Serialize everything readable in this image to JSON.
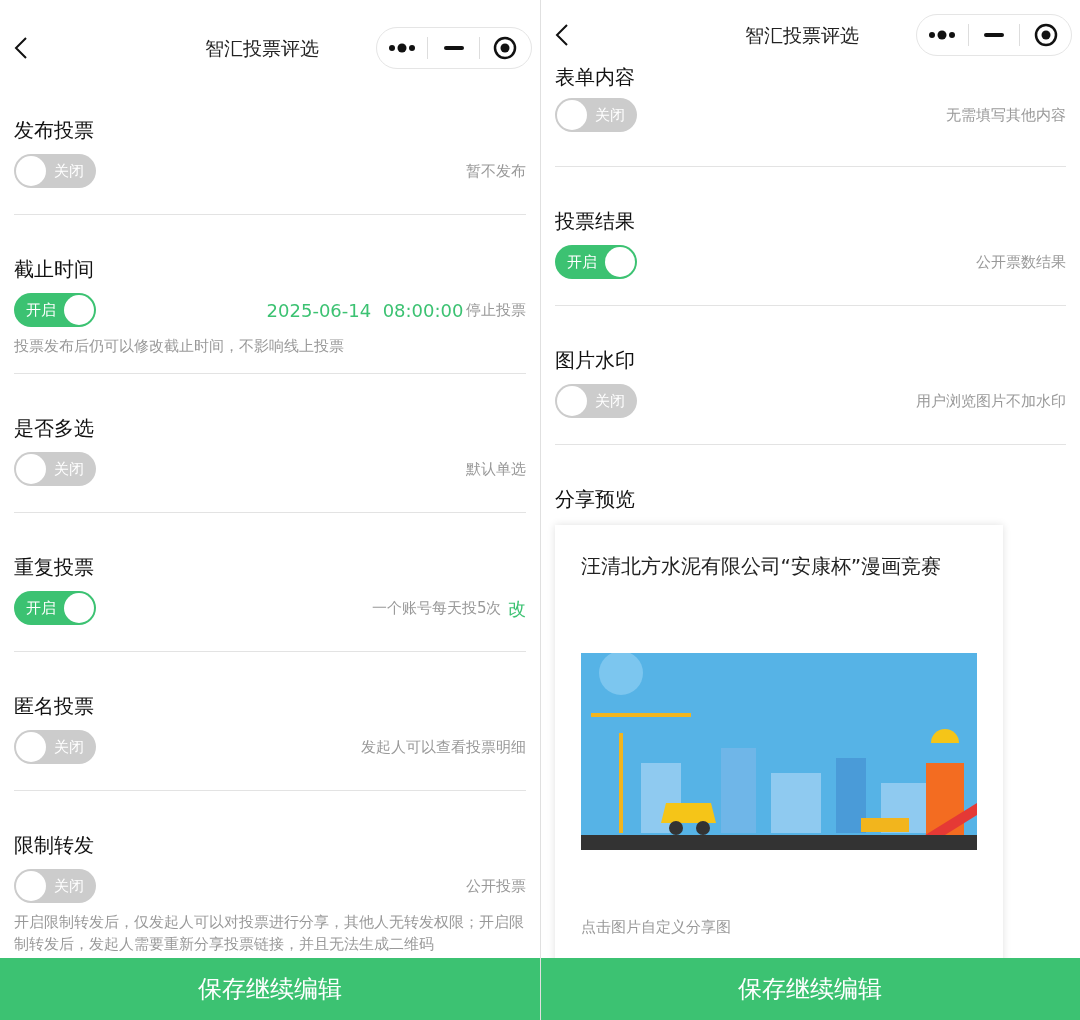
{
  "panels": [
    {
      "header": {
        "title": "智汇投票评选"
      },
      "sections": [
        {
          "kind": "toggle",
          "title": "发布投票",
          "switch": {
            "on": false,
            "label": "关闭"
          },
          "hint": "暂不发布"
        },
        {
          "kind": "toggle",
          "title": "截止时间",
          "switch": {
            "on": true,
            "label": "开启"
          },
          "datetime": "2025-06-14  08:00:00",
          "hint": "停止投票",
          "note": "投票发布后仍可以修改截止时间，不影响线上投票"
        },
        {
          "kind": "toggle",
          "title": "是否多选",
          "switch": {
            "on": false,
            "label": "关闭"
          },
          "hint": "默认单选"
        },
        {
          "kind": "toggle",
          "title": "重复投票",
          "switch": {
            "on": true,
            "label": "开启"
          },
          "hint": "一个账号每天投5次",
          "action": "改"
        },
        {
          "kind": "toggle",
          "title": "匿名投票",
          "switch": {
            "on": false,
            "label": "关闭"
          },
          "hint": "发起人可以查看投票明细"
        },
        {
          "kind": "toggle",
          "title": "限制转发",
          "switch": {
            "on": false,
            "label": "关闭"
          },
          "hint": "公开投票",
          "note": "开启限制转发后，仅发起人可以对投票进行分享，其他人无转发权限；开启限制转发后，发起人需要重新分享投票链接，并且无法生成二维码"
        }
      ],
      "footer_button": "保存继续编辑"
    },
    {
      "header": {
        "title": "智汇投票评选"
      },
      "sections": [
        {
          "kind": "toggle",
          "title": "表单内容",
          "switch": {
            "on": false,
            "label": "关闭"
          },
          "hint": "无需填写其他内容"
        },
        {
          "kind": "toggle",
          "title": "投票结果",
          "switch": {
            "on": true,
            "label": "开启"
          },
          "hint": "公开票数结果"
        },
        {
          "kind": "toggle",
          "title": "图片水印",
          "switch": {
            "on": false,
            "label": "关闭"
          },
          "hint": "用户浏览图片不加水印"
        },
        {
          "kind": "share_preview",
          "title": "分享预览",
          "card": {
            "title": "汪清北方水泥有限公司“安康杯”漫画竞赛",
            "hint": "点击图片自定义分享图"
          }
        }
      ],
      "footer_button": "保存继续编辑"
    }
  ]
}
